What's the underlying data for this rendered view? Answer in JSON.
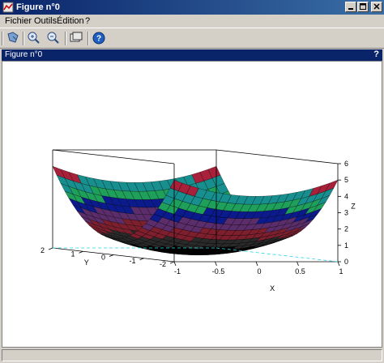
{
  "window": {
    "title": "Figure n°0"
  },
  "menu": {
    "items": [
      "Fichier",
      "Outils",
      "Édition",
      "?"
    ]
  },
  "panel": {
    "title": "Figure n°0",
    "help_label": "?"
  },
  "toolbar": {
    "icons": [
      "rotate-icon",
      "zoom-icon",
      "unzoom-icon",
      "graphics-window-icon",
      "help-icon"
    ]
  },
  "chart_data": {
    "type": "surface",
    "title": "",
    "axes": {
      "x": {
        "label": "X",
        "ticks": [
          "-1",
          "-0.5",
          "0",
          "0.5",
          "1"
        ],
        "range": [
          -1,
          1
        ]
      },
      "y": {
        "label": "Y",
        "ticks": [
          "-2",
          "-1",
          "0",
          "1",
          "2"
        ],
        "range": [
          -2,
          2
        ]
      },
      "z": {
        "label": "Z",
        "ticks": [
          "0",
          "1",
          "2",
          "3",
          "4",
          "5",
          "6"
        ],
        "range": [
          0,
          6
        ]
      }
    },
    "function": "z = x^2 + y^2 (paraboloid, colored bands by height)",
    "colors": [
      "#000000",
      "#2a2a2a",
      "#7e1f2e",
      "#5b2d6b",
      "#0b1a8c",
      "#1ea05a",
      "#178f8f",
      "#a8203a",
      "#c7c73a",
      "#8a6d55"
    ]
  }
}
